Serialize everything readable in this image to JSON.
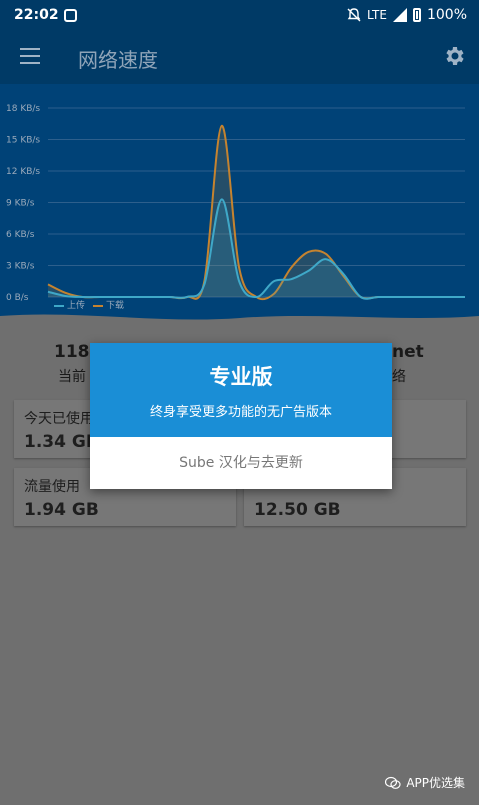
{
  "status_bar": {
    "time": "22:02",
    "network": "LTE",
    "battery": "100%"
  },
  "app_bar": {
    "title": "网络速度"
  },
  "chart_data": {
    "type": "area",
    "y_ticks": [
      "18 KB/s",
      "15 KB/s",
      "12 KB/s",
      "9 KB/s",
      "6 KB/s",
      "3 KB/s",
      "0 B/s"
    ],
    "ylim": [
      0,
      18
    ],
    "y_unit": "KB/s",
    "series": [
      {
        "name": "上传",
        "color": "#3fa8c8",
        "values": [
          0.5,
          0.1,
          0,
          0,
          0,
          0,
          0,
          0,
          0,
          1.2,
          9.3,
          1.5,
          0,
          1.5,
          1.7,
          2.5,
          3.6,
          2.2,
          0,
          0,
          0,
          0,
          0,
          0,
          0
        ]
      },
      {
        "name": "下载",
        "color": "#c5832f",
        "values": [
          1.2,
          0.4,
          0,
          0,
          0,
          0,
          0,
          0,
          0,
          1.5,
          16.3,
          2.8,
          0,
          0.3,
          2.8,
          4.3,
          4.1,
          2.0,
          0,
          0,
          0,
          0,
          0,
          0,
          0
        ]
      }
    ]
  },
  "stats": {
    "left_value": "118",
    "left_label": "当前",
    "right_value": "net",
    "right_label": "络"
  },
  "cards": [
    {
      "label": "今天已使用",
      "value": "1.34 GB"
    },
    {
      "label": "",
      "value": ""
    },
    {
      "label": "流量使用",
      "value": "1.94 GB"
    },
    {
      "label": "",
      "value": "12.50 GB"
    }
  ],
  "dialog": {
    "title": "专业版",
    "subtitle": "终身享受更多功能的无广告版本",
    "action": "Sube 汉化与去更新"
  },
  "watermark": {
    "text": "APP优选集"
  }
}
